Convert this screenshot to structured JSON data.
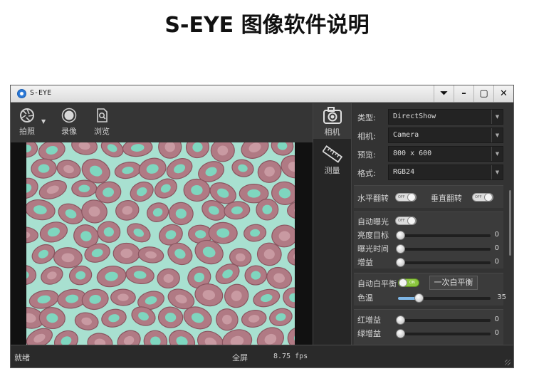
{
  "doc_title": "S-EYE  图像软件说明",
  "window": {
    "title": "S-EYE",
    "controls": {
      "menu": "⏷",
      "minimize": "–",
      "maximize": "▢",
      "close": "✕"
    }
  },
  "toolbar": {
    "capture_label": "拍照",
    "record_label": "录像",
    "browse_label": "浏览"
  },
  "sidenav": {
    "camera_label": "相机",
    "measure_label": "测量"
  },
  "camera_settings": {
    "type_label": "类型:",
    "type_value": "DirectShow",
    "camera_label": "相机:",
    "camera_value": "Camera",
    "preview_label": "预览:",
    "preview_value": "800 x 600",
    "format_label": "格式:",
    "format_value": "RGB24"
  },
  "flip": {
    "horizontal_label": "水平翻转",
    "horizontal_state": "OFF",
    "vertical_label": "垂直翻转",
    "vertical_state": "OFF"
  },
  "exposure": {
    "auto_label": "自动曝光",
    "auto_state": "OFF",
    "brightness_label": "亮度目标",
    "brightness_value": "0",
    "time_label": "曝光时间",
    "time_value": "0",
    "gain_label": "增益",
    "gain_value": "0"
  },
  "white_balance": {
    "auto_label": "自动白平衡",
    "auto_state": "ON",
    "once_button": "一次白平衡",
    "temp_label": "色温",
    "temp_value": "35",
    "temp_level": 0.22
  },
  "rgb_gain": {
    "red_label": "红增益",
    "red_value": "0",
    "green_label": "绿增益",
    "green_value": "0"
  },
  "status": {
    "text": "就绪",
    "fullscreen_label": "全屏",
    "fps": "8.75 fps"
  },
  "colors": {
    "tissue_background": "#a8e0d0",
    "tubule_stain": "#b07a84",
    "lumen": "#7fd6bf",
    "accent_on": "#8cc63f"
  }
}
